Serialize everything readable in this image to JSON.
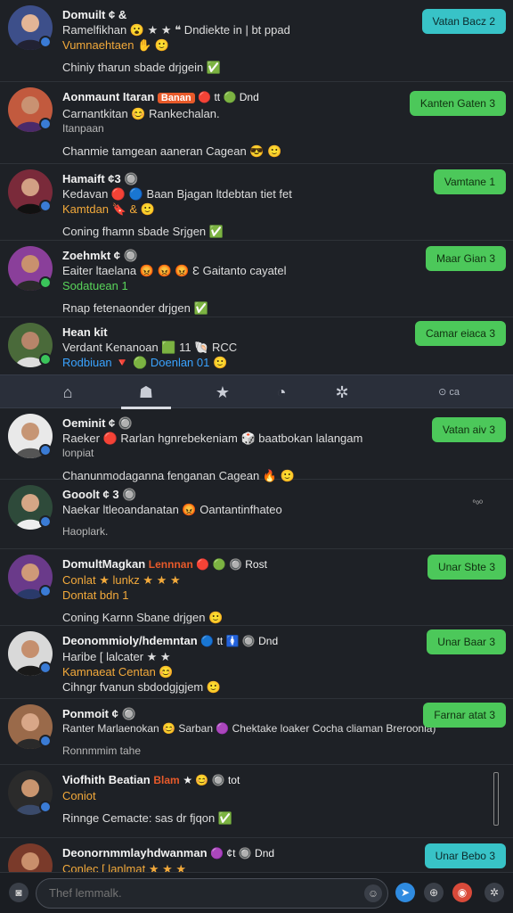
{
  "feed": [
    {
      "name": "Domuilt ¢ &",
      "line1": "Ramelfikhan 😮 ★ ★ ❝ Dndiekte in | bt ppad",
      "line2": "Vumnaehtaen ✋ 🙂",
      "line3": "Chiniy tharun sbade drjgein ✅",
      "action": "Vatan Bacz 2",
      "action_color": "teal",
      "avatar_color": "#3d4f8a",
      "badge_color": "#3a7bd5"
    },
    {
      "name": "Aonmaunt Itaran",
      "tag": "Banan",
      "tag2": "🔴 tt 🟢 Dnd",
      "line1": "Carnantkitan 😊 Rankechalan.",
      "line2": "Itanpaan",
      "line3": "Chanmie tamgean aaneran Cagean 😎 🙂",
      "action": "Kanten Gaten 3",
      "action_color": "green",
      "avatar_color": "#c25a3e",
      "badge_color": "#3a7bd5"
    },
    {
      "name": "Hamaift ¢3 🔘",
      "line1": "Kedavan 🔴 🔵 Baan Bjagan ltdebtan tiet fet",
      "line2": "Kamtdan 🔖 & 🙂",
      "line3": "Coning fhamn sbade Srjgen ✅",
      "action": "Vamtane 1",
      "action_color": "green",
      "avatar_color": "#7a2a3a",
      "badge_color": "#3a7bd5"
    },
    {
      "name": "Zoehmkt ¢ 🔘",
      "line1": "Eaiter ltaelana 😡 😡 😡 Ɛ Gaitanto cayatel",
      "line2": "Sodatuean 1",
      "line3": "Rnap fetenaonder drjgen ✅",
      "action": "Maar Gian 3",
      "action_color": "green",
      "avatar_color": "#8a3f9a",
      "badge_color": "#3ac45a"
    },
    {
      "name": "Hean kit",
      "line1": "Verdant Kenanoan 🟩 11 🐚 RCC",
      "line2": "Rodbiuan 🔻 🟢 Doenlan 01 🙂",
      "action": "Camar eiaca 3",
      "action_color": "green",
      "avatar_color": "#4a6a3a",
      "badge_color": "#3ac45a"
    }
  ],
  "tabbar": {
    "home_icon": "home-icon",
    "tab_label": "⊙ ca"
  },
  "feed2": [
    {
      "name": "Oeminit ¢ 🔘",
      "line1": "Raeker 🔴 Rarlan hgnrebekeniam 🎲 baatbokan lalangam",
      "line2": "lonpiat",
      "line3": "Chanunmodaganna fenganan Cagean 🔥 🙂",
      "action": "Vatan aiv 3",
      "action_color": "green",
      "avatar_color": "#e9e9e9",
      "badge_color": "#3a7bd5"
    },
    {
      "name": "Gooolt ¢ 3 🔘",
      "line1": "Naekar ltleoandanatan 😡 Oantantinfhateo",
      "line2": "Haoplark.",
      "side": "°ᵒ⁰",
      "action": "",
      "action_color": "",
      "avatar_color": "#2e4a3a",
      "badge_color": "#3a7bd5"
    },
    {
      "name": "DomultMagkan",
      "tag": "Lennnan",
      "tag2": "🔴 🟢 🔘 Rost",
      "line1": "Conlat ★ lunkz ★ ★ ★",
      "line2": "Dontat bdn 1",
      "line3": "Coning Karnn Sbane drjgen 🙂",
      "action": "Unar Sbte 3",
      "action_color": "green",
      "avatar_color": "#6a3a8a",
      "badge_color": "#3a7bd5"
    },
    {
      "name": "Deonommioly/hdemntan",
      "tag2": "🔵 tt 🚺 🔘 Dnd",
      "line1": "Haribe [ lalcater ★ ★",
      "line2": "Kamnaeat Centan 😊",
      "line3": "Cihngr fvanun sbdodgjgjem 🙂",
      "action": "Unar Baar 3",
      "action_color": "green",
      "avatar_color": "#d9d9d9",
      "badge_color": "#3a7bd5"
    },
    {
      "name": "Ponmoit ¢ 🔘",
      "line1": "Ranter Marlaenokan 😊 Sarban 🟣 Chektake loaker Cocha cliaman Breroonia)",
      "line2": "Ronnmmim tahe",
      "action": "Farnar atat 3",
      "action_color": "green",
      "avatar_color": "#9a6a4a",
      "badge_color": "#3a7bd5"
    },
    {
      "name": "Viofhith Beatian",
      "tag": "Blam",
      "tag2": "★ 😊 🔘 tot",
      "line1": "Coniot",
      "line2": "Rinnge Cemacte: sas dr fjqon ✅",
      "action": "",
      "action_color": "",
      "avatar_color": "#2b2b2b",
      "badge_color": "#3a7bd5"
    },
    {
      "name": "Deonornmmlayhdwanman",
      "tag2": "🟣 ¢t 🔘 Dnd",
      "line1": "Conlec [ lanlmat ★ ★ ★",
      "action": "Unar Bebo 3",
      "action_color": "teal",
      "avatar_color": "#7a3a2a",
      "badge_color": "#3a7bd5"
    }
  ],
  "composer": {
    "placeholder": "Thef lemmalk."
  }
}
